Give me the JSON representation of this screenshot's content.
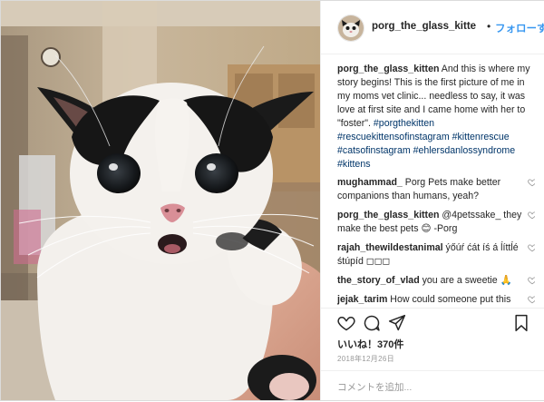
{
  "post": {
    "username": "porg_the_glass_kitte",
    "follow_label": "フォローする",
    "caption": {
      "user": "porg_the_glass_kitten",
      "text": " And this is where my story begins! This is the first picture of me in my moms vet clinic... needless to say, it was love at first site and I came home with her to \"foster\". ",
      "hashtags": [
        "#porgthekitten",
        "#rescuekittensofinstagram",
        "#kittenrescue",
        "#catsofinstagram",
        "#ehlersdanlossyndrome",
        "#kittens"
      ]
    },
    "comments": [
      {
        "user": "mughammad_",
        "text": " Porg Pets make better companions than humans, yeah?"
      },
      {
        "user": "porg_the_glass_kitten",
        "text": " @4petssake_ they make the best pets 😊 -Porg"
      },
      {
        "user": "rajah_thewildestanimal",
        "text": " ýőúŕ ćát íś á ĺíttĺé śtúpíd ◻◻◻"
      },
      {
        "user": "the_story_of_vlad",
        "text": " you are a sweetie 🙏"
      },
      {
        "user": "jejak_tarim",
        "text": " How could someone put this cute kitten in the box??? Anyway, you safe now in the hands of your kind mumm. Porgie!😂😂"
      }
    ],
    "likes": "いいね！370件",
    "date": "2018年12月26日",
    "add_comment_placeholder": "コメントを追加..."
  },
  "icons": {
    "like": "heart-icon",
    "comment": "speech-bubble-icon",
    "share": "paper-plane-icon",
    "save": "bookmark-icon"
  },
  "colors": {
    "link_blue": "#3897f0",
    "hashtag": "#003569",
    "border": "#efefef",
    "muted": "#999999"
  }
}
